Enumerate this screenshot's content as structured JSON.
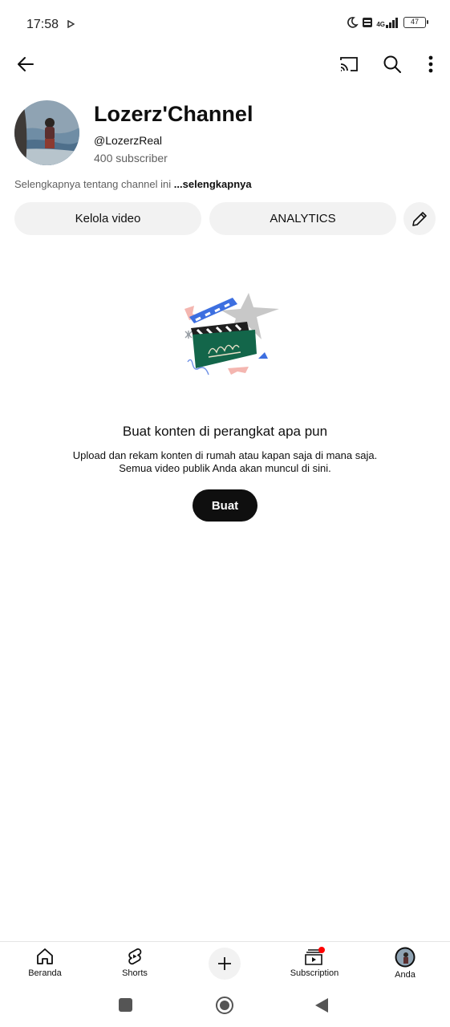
{
  "status_bar": {
    "time": "17:58",
    "network": "4G",
    "battery": "47"
  },
  "top_bar": {
    "icons": [
      "back-arrow-icon",
      "cast-icon",
      "search-icon",
      "more-vert-icon"
    ]
  },
  "channel": {
    "name": "Lozerz'Channel",
    "handle": "@LozerzReal",
    "subscribers": "400 subscriber",
    "about_text": "Selengkapnya tentang channel ini",
    "about_more": "...selengkapnya"
  },
  "actions": {
    "manage_videos": "Kelola video",
    "analytics": "ANALYTICS"
  },
  "empty_state": {
    "title": "Buat konten di perangkat apa pun",
    "line1": "Upload dan rekam konten di rumah atau kapan saja di mana saja.",
    "line2": "Semua video publik Anda akan muncul di sini.",
    "button": "Buat"
  },
  "bottom_nav": {
    "home": "Beranda",
    "shorts": "Shorts",
    "subscription": "Subscription",
    "you": "Anda"
  },
  "colors": {
    "accent_red": "#ff0000",
    "text_primary": "#0f0f0f",
    "text_secondary": "#606060",
    "pill_bg": "#f2f2f2"
  }
}
